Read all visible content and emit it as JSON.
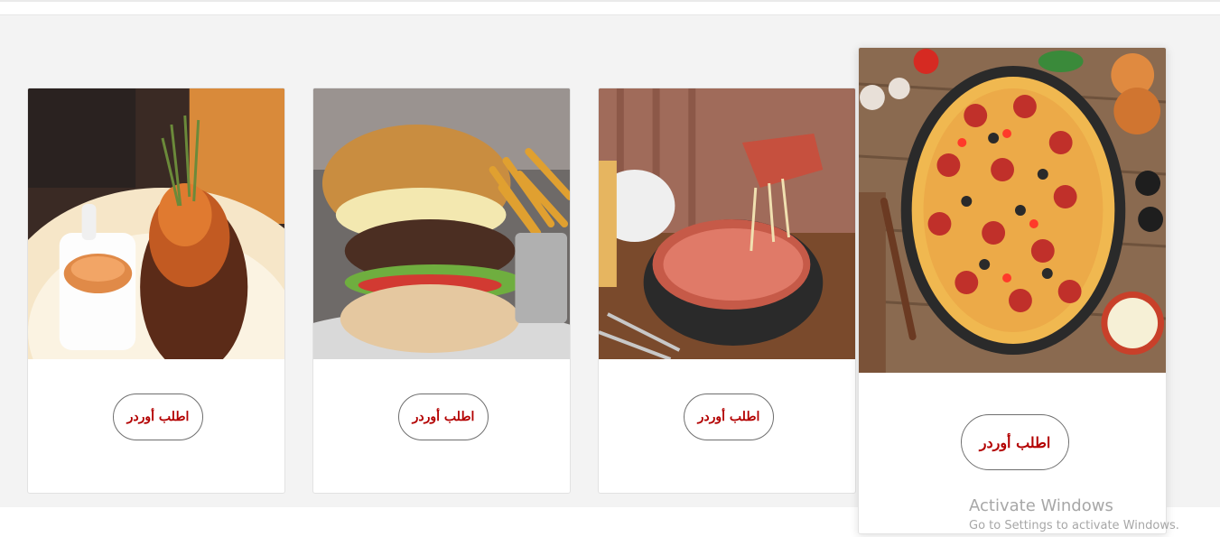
{
  "cards": [
    {
      "image": "grilled-meat-dish-image",
      "button_label": "اطلب أوردر"
    },
    {
      "image": "burger-and-fries-image",
      "button_label": "اطلب أوردر"
    },
    {
      "image": "deep-dish-pizza-image",
      "button_label": "اطلب أوردر"
    },
    {
      "image": "pepperoni-pizza-image",
      "button_label": "اطلب أوردر"
    }
  ],
  "watermark": {
    "title": "Activate Windows",
    "subtitle": "Go to Settings to activate Windows."
  },
  "colors": {
    "button_text": "#b30000",
    "section_background": "#f3f3f3",
    "card_background": "#ffffff"
  }
}
